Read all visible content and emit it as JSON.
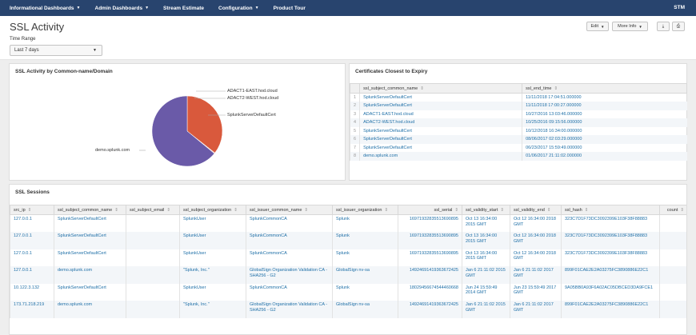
{
  "nav": {
    "items": [
      "Informational Dashboards",
      "Admin Dashboards",
      "Stream Estimate",
      "Configuration",
      "Product Tour"
    ],
    "brand": "STM"
  },
  "header": {
    "title": "SSL Activity",
    "time_range_label": "Time Range",
    "time_range_value": "Last 7 days",
    "edit_label": "Edit",
    "more_info_label": "More Info"
  },
  "pie_panel": {
    "title": "SSL Activity by Common-name/Domain",
    "labels": {
      "adact1": "ADACT1-EAST.hod.cloud",
      "adact2": "ADACT2-WEST.hod.cloud",
      "splunk": "SplunkServerDefaultCert",
      "demo": "demo.splunk.com"
    },
    "colors": {
      "demo": "#6a5aa8",
      "splunk": "#d9593c",
      "adact": "#d9593c"
    }
  },
  "chart_data": {
    "type": "pie",
    "title": "SSL Activity by Common-name/Domain",
    "categories": [
      "demo.splunk.com",
      "SplunkServerDefaultCert",
      "ADACT2-WEST.hod.cloud",
      "ADACT1-EAST.hod.cloud"
    ],
    "values": [
      64,
      35.6,
      0.2,
      0.2
    ]
  },
  "expiry": {
    "title": "Certificates Closest to Expiry",
    "columns": [
      "ssl_subject_common_name",
      "ssl_end_time"
    ],
    "rows": [
      [
        "1",
        "SplunkServerDefaultCert",
        "11/11/2018 17:04:51.000000"
      ],
      [
        "2",
        "SplunkServerDefaultCert",
        "11/11/2018 17:00:27.000000"
      ],
      [
        "3",
        "ADACT1-EAST.hod.cloud",
        "10/27/2016 13:03:46.000000"
      ],
      [
        "4",
        "ADACT2-WEST.hod.cloud",
        "10/25/2016 09:15:56.000000"
      ],
      [
        "5",
        "SplunkServerDefaultCert",
        "10/12/2018 16:34:00.000000"
      ],
      [
        "6",
        "SplunkServerDefaultCert",
        "08/06/2017 02:03:29.000000"
      ],
      [
        "7",
        "SplunkServerDefaultCert",
        "06/23/2017 15:59:49.000000"
      ],
      [
        "8",
        "demo.splunk.com",
        "01/06/2017 21:11:02.000000"
      ]
    ]
  },
  "sessions": {
    "title": "SSL Sessions",
    "columns": [
      "src_ip",
      "ssl_subject_common_name",
      "ssl_subject_email",
      "ssl_subject_organization",
      "ssl_issuer_common_name",
      "ssl_issuer_organization",
      "ssl_serial",
      "ssl_validity_start",
      "ssl_validity_end",
      "ssl_hash",
      "count"
    ],
    "rows": [
      [
        "127.0.0.1",
        "SplunkServerDefaultCert",
        "",
        "SplunkUser",
        "SplunkCommonCA",
        "Splunk",
        "16971932835513690895",
        "Oct 13 16:34:00 2015 GMT",
        "Oct 12 16:34:00 2018 GMT",
        "323C7D1F73DC3092399E103F38F88883",
        ""
      ],
      [
        "127.0.0.1",
        "SplunkServerDefaultCert",
        "",
        "SplunkUser",
        "SplunkCommonCA",
        "Splunk",
        "16971932835513690895",
        "Oct 13 16:34:00 2015 GMT",
        "Oct 12 16:34:00 2018 GMT",
        "323C7D1F73DC3092399E103F38F88883",
        ""
      ],
      [
        "127.0.0.1",
        "SplunkServerDefaultCert",
        "",
        "SplunkUser",
        "SplunkCommonCA",
        "Splunk",
        "16971932835513690895",
        "Oct 13 16:34:00 2015 GMT",
        "Oct 12 16:34:00 2018 GMT",
        "323C7D1F73DC3092399E103F38F88883",
        ""
      ],
      [
        "127.0.0.1",
        "demo.splunk.com",
        "",
        "\"Splunk, Inc.\"",
        "GlobalSign Organization Validation CA - SHA256 - G2",
        "GlobalSign nv-sa",
        "14924691419363672425",
        "Jan 6 21:11:02 2015 GMT",
        "Jan 6 21:11:02 2017 GMT",
        "899F01CAE2E2A03275FC3890886E22C1",
        ""
      ],
      [
        "10.122.3.132",
        "SplunkServerDefaultCert",
        "",
        "SplunkUser",
        "SplunkCommonCA",
        "Splunk",
        "18029456674544460668",
        "Jun 24 15:59:49 2014 GMT",
        "Jun 23 15:59:49 2017 GMT",
        "9A05BB0A93F6A02AC05DBCED3DA9FCE1",
        ""
      ],
      [
        "173.71.218.219",
        "demo.splunk.com",
        "",
        "\"Splunk, Inc.\"",
        "GlobalSign Organization Validation CA - SHA256 - G2",
        "GlobalSign nv-sa",
        "14924691419363672425",
        "Jan 6 21:11:02 2015 GMT",
        "Jan 6 21:11:02 2017 GMT",
        "899F01CAE2E2A03275FC3890886E22C1",
        ""
      ]
    ]
  }
}
